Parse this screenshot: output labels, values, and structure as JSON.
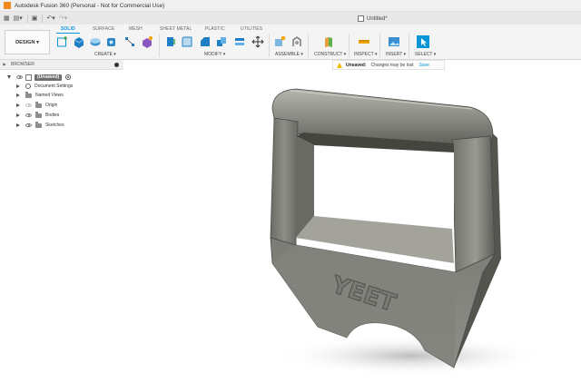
{
  "app": {
    "title": "Autodesk Fusion 360 (Personal - Not for Commercial Use)",
    "document_tab": "Untitled*"
  },
  "toolbar": {
    "workspace_button": "DESIGN",
    "tabs": [
      "SOLID",
      "SURFACE",
      "MESH",
      "SHEET METAL",
      "PLASTIC",
      "UTILITIES"
    ],
    "active_tab": "SOLID",
    "groups": {
      "create": "CREATE",
      "modify": "MODIFY",
      "assemble": "ASSEMBLE",
      "construct": "CONSTRUCT",
      "inspect": "INSPECT",
      "insert": "INSERT",
      "select": "SELECT"
    },
    "accent_color": "#0696d7"
  },
  "browser": {
    "title": "BROWSER",
    "root": "(Unsaved)",
    "items": [
      "Document Settings",
      "Named Views",
      "Origin",
      "Bodies",
      "Sketches"
    ]
  },
  "banner": {
    "label": "Unsaved:",
    "message": "Changes may be lost",
    "save": "Save"
  },
  "model": {
    "embossed_text": "YEET",
    "body_color": "#8a8a84"
  }
}
